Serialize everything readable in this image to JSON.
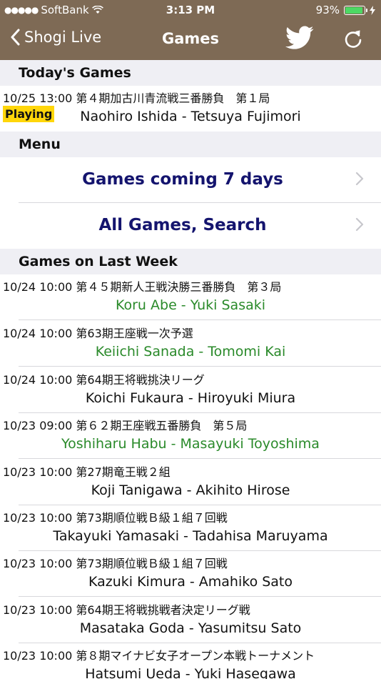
{
  "status_bar": {
    "carrier": "SoftBank",
    "time": "3:13 PM",
    "battery": "93%",
    "battery_level": 0.93
  },
  "nav": {
    "back_label": "Shogi Live",
    "title": "Games"
  },
  "today": {
    "header": "Today's Games",
    "games": [
      {
        "meta": "10/25 13:00 第４期加古川青流戦三番勝負　第１局",
        "players": "Naohiro Ishida - Tetsuya Fujimori",
        "badge": "Playing",
        "color": "#111111"
      }
    ]
  },
  "menu": {
    "header": "Menu",
    "items": [
      {
        "label": "Games coming 7 days"
      },
      {
        "label": "All Games, Search"
      }
    ]
  },
  "last_week": {
    "header": "Games on Last Week",
    "games": [
      {
        "meta": "10/24 10:00 第４５期新人王戦決勝三番勝負　第３局",
        "players": "Koru Abe - Yuki Sasaki",
        "color": "#2a8a2a"
      },
      {
        "meta": "10/24 10:00 第63期王座戦一次予選",
        "players": "Keiichi Sanada - Tomomi Kai",
        "color": "#2a8a2a"
      },
      {
        "meta": "10/24 10:00 第64期王将戦挑決リーグ",
        "players": "Koichi Fukaura - Hiroyuki Miura",
        "color": "#111111"
      },
      {
        "meta": "10/23 09:00 第６２期王座戦五番勝負　第５局",
        "players": "Yoshiharu Habu - Masayuki Toyoshima",
        "color": "#2a8a2a"
      },
      {
        "meta": "10/23 10:00 第27期竜王戦２組",
        "players": "Koji Tanigawa - Akihito Hirose",
        "color": "#111111"
      },
      {
        "meta": "10/23 10:00 第73期順位戦Ｂ級１組７回戦",
        "players": "Takayuki Yamasaki - Tadahisa Maruyama",
        "color": "#111111"
      },
      {
        "meta": "10/23 10:00 第73期順位戦Ｂ級１組７回戦",
        "players": "Kazuki Kimura - Amahiko Sato",
        "color": "#111111"
      },
      {
        "meta": "10/23 10:00 第64期王将戦挑戦者決定リーグ戦",
        "players": "Masataka Goda - Yasumitsu Sato",
        "color": "#111111"
      },
      {
        "meta": "10/23 10:00 第８期マイナビ女子オープン本戦トーナメント",
        "players": "Hatsumi Ueda - Yuki Hasegawa",
        "color": "#111111"
      }
    ]
  }
}
